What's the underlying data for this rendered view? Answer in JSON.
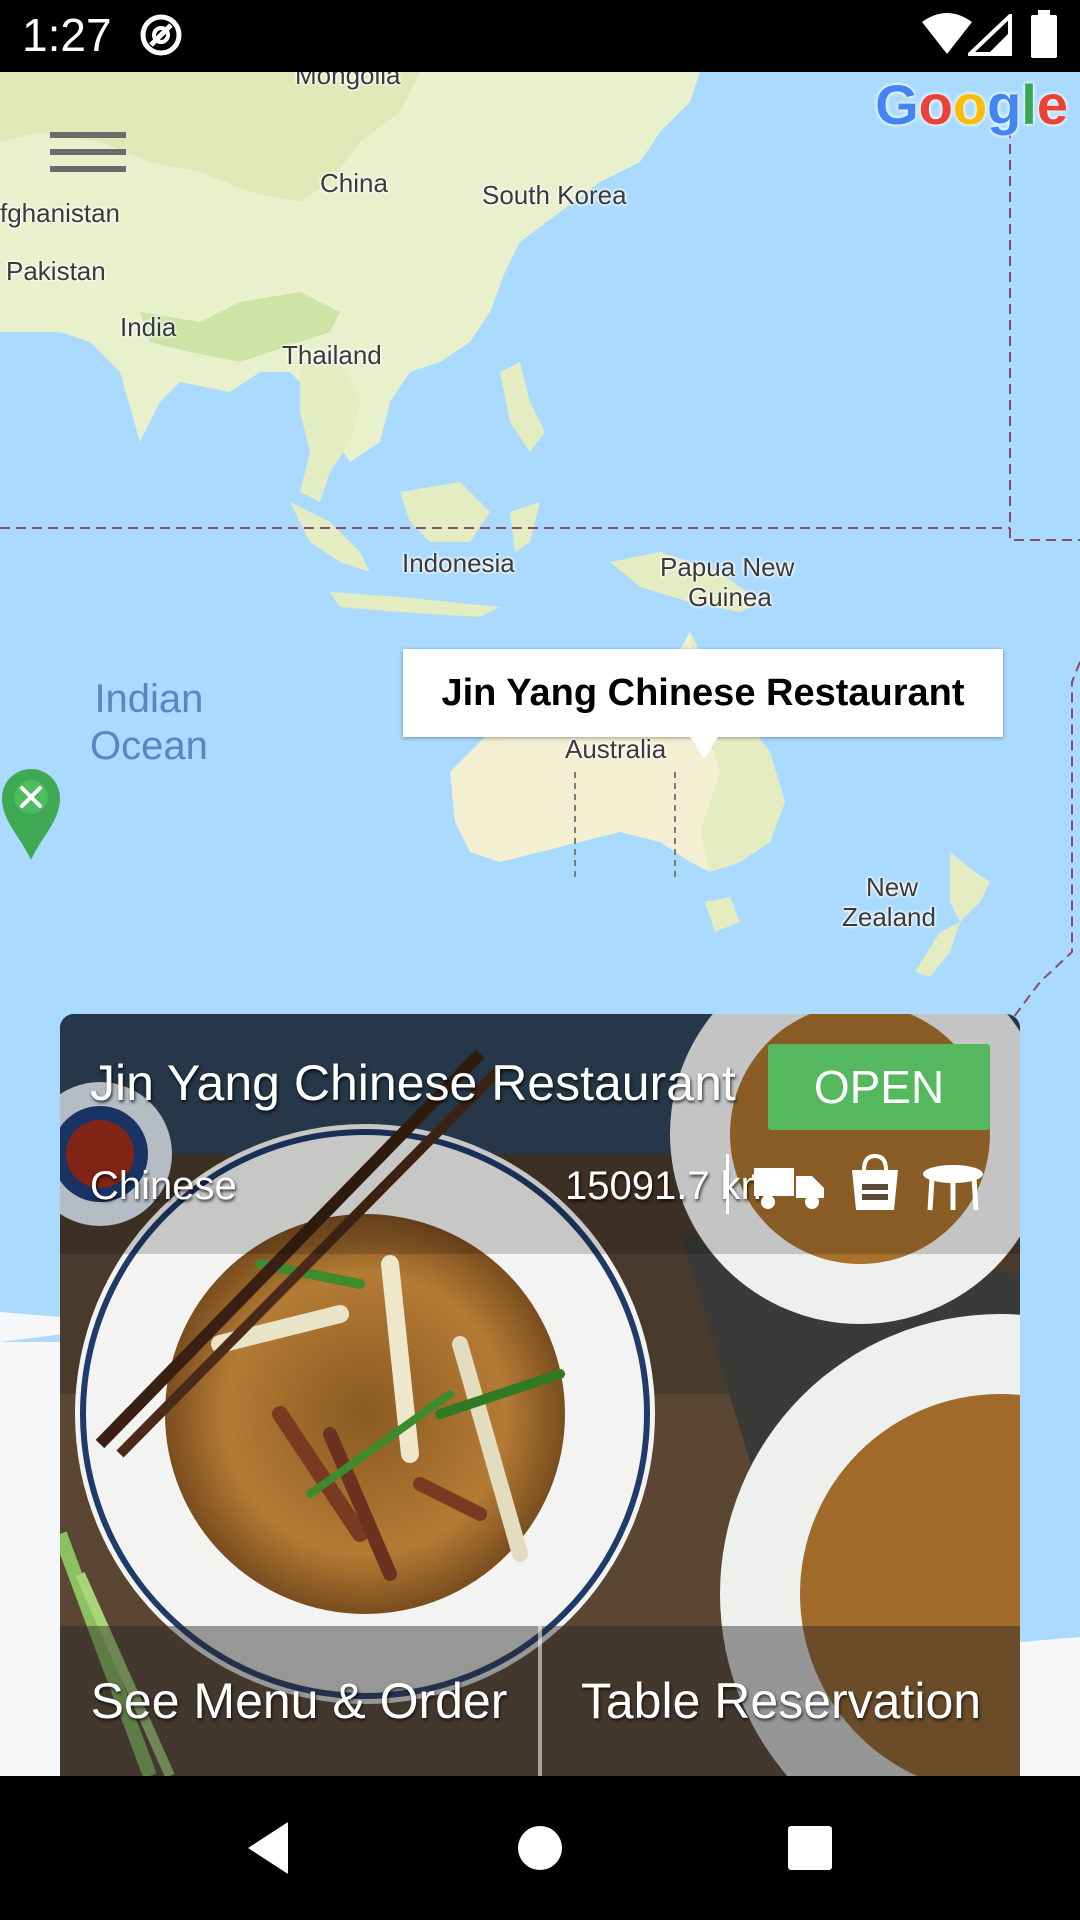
{
  "status_bar": {
    "time": "1:27",
    "icons": [
      "no-disturb-icon",
      "wifi-icon",
      "cell-signal-icon",
      "battery-icon"
    ]
  },
  "map": {
    "labels": {
      "mongolia": "Mongolia",
      "china": "China",
      "south_korea": "South Korea",
      "afghanistan": "fghanistan",
      "pakistan": "Pakistan",
      "india": "India",
      "thailand": "Thailand",
      "indonesia": "Indonesia",
      "papua_new_guinea_1": "Papua New",
      "papua_new_guinea_2": "Guinea",
      "australia": "Australia",
      "new_zealand_1": "New",
      "new_zealand_2": "Zealand",
      "indian_ocean_1": "Indian",
      "indian_ocean_2": "Ocean"
    },
    "attribution": "Google",
    "info_window_title": "Jin Yang Chinese Restaurant",
    "marker_icon": "fork-knife-pin-icon",
    "colors": {
      "water": "#aadaff",
      "land": "#f2efd9",
      "marker": "#3ea853"
    }
  },
  "restaurant": {
    "name": "Jin Yang Chinese Restaurant",
    "status": "OPEN",
    "cuisine": "Chinese",
    "distance": "15091.7 km",
    "service_icons": [
      "delivery-truck-icon",
      "takeaway-bag-icon",
      "dine-in-table-icon"
    ],
    "actions": {
      "menu": "See Menu & Order",
      "reservation": "Table Reservation"
    },
    "colors": {
      "open": "#55b85e"
    }
  },
  "nav_bar": {
    "icons": [
      "back-icon",
      "home-icon",
      "recents-icon"
    ]
  }
}
